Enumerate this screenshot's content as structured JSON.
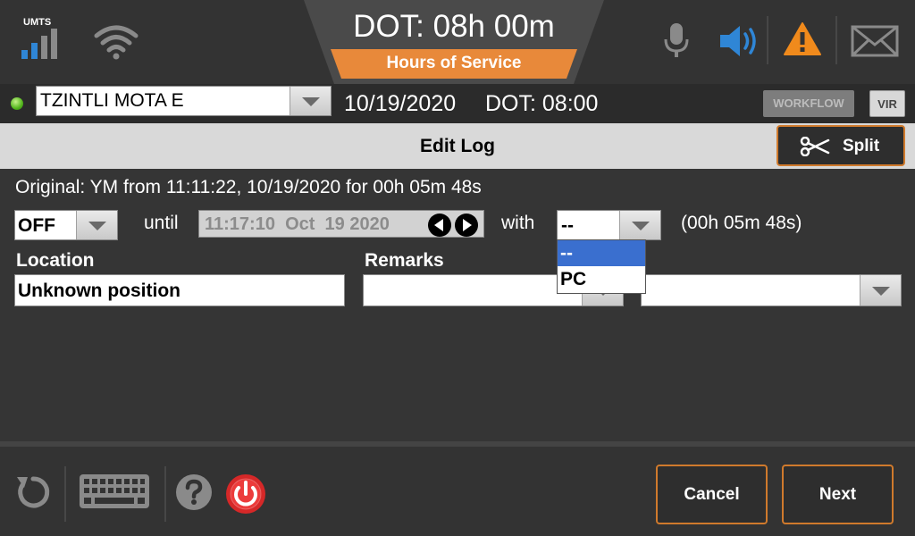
{
  "status_bar": {
    "network_label": "UMTS",
    "dot_timer": "DOT: 08h 00m",
    "hos_tab_label": "Hours of Service",
    "colors": {
      "accent_orange": "#e8893a",
      "speaker_blue": "#2f86d6",
      "warning_orange": "#f08a1c"
    }
  },
  "driver_row": {
    "driver_name": "TZINTLI MOTA E",
    "date": "10/19/2020",
    "dot": "DOT: 08:00",
    "workflow_label": "WORKFLOW",
    "vir_label": "VIR"
  },
  "title_bar": {
    "title": "Edit Log",
    "split_label": "Split"
  },
  "form": {
    "original_text": "Original: YM from 11:11:22, 10/19/2020 for 00h 05m 48s",
    "status_value": "OFF",
    "until_label": "until",
    "until_value": "11:17:10  Oct  19 2020",
    "with_label": "with",
    "with_value": "--",
    "duration": "(00h 05m 48s)",
    "location_label": "Location",
    "location_value": "Unknown position",
    "remarks_label": "Remarks",
    "with_options": [
      "--",
      "PC"
    ],
    "with_selected_index": 0
  },
  "footer": {
    "cancel_label": "Cancel",
    "next_label": "Next"
  }
}
